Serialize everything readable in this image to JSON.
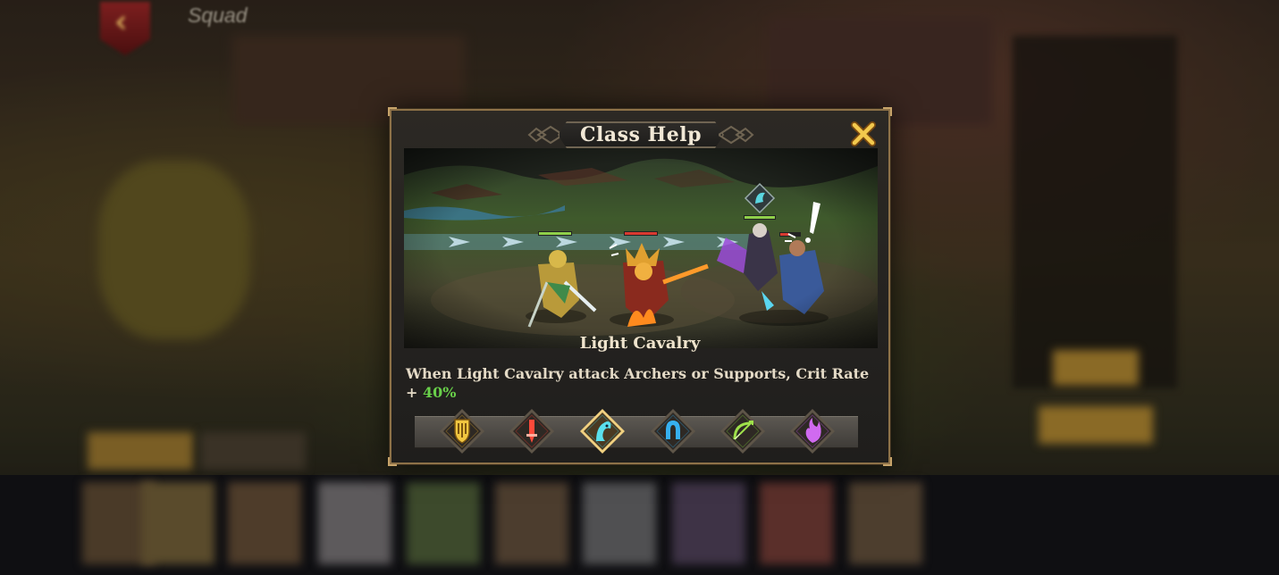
{
  "header": {
    "title": "Squad"
  },
  "modal": {
    "title": "Class Help",
    "unit_name": "Light Cavalry",
    "description_main": "When Light Cavalry attack Archers or Supports, Crit Rate + ",
    "description_value": "40%"
  },
  "classes": [
    {
      "icon": "shield-icon",
      "color": "#d4a12a",
      "selected": false
    },
    {
      "icon": "sword-icon",
      "color": "#d63a2e",
      "selected": false
    },
    {
      "icon": "horse-head-icon",
      "color": "#3fc7d4",
      "selected": true
    },
    {
      "icon": "horseshoe-icon",
      "color": "#2f9bd8",
      "selected": false
    },
    {
      "icon": "bow-icon",
      "color": "#7bc23a",
      "selected": false
    },
    {
      "icon": "magic-flame-icon",
      "color": "#b24fd8",
      "selected": false
    }
  ]
}
